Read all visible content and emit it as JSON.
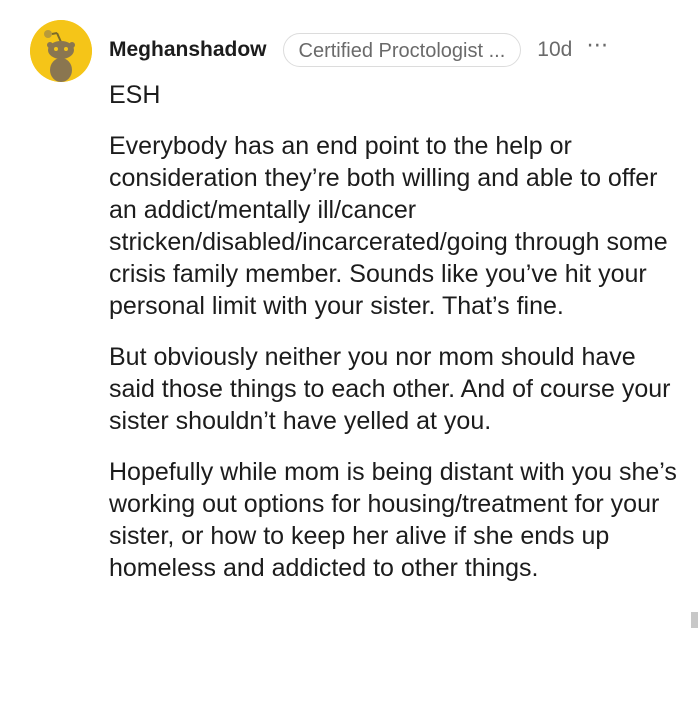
{
  "comment": {
    "username": "Meghanshadow",
    "flair": "Certified Proctologist ...",
    "timestamp": "10d",
    "more_icon": "⋯",
    "paragraphs": [
      "ESH",
      "Everybody has an end point to the help or consideration they’re both willing and able to offer an addict/mentally ill/cancer stricken/disabled/incarcerated/going through some crisis family member. Sounds like you’ve hit your personal limit with your sister. That’s fine.",
      "But obviously neither you nor mom should have said those things to each other. And of course your sister shouldn’t have yelled at you.",
      "Hopefully while mom is being distant with you she’s working out options for housing/treatment for your sister, or how to keep her alive if she ends up homeless and addicted to other things."
    ]
  },
  "colors": {
    "avatar_bg": "#f5c518",
    "text": "#1c1c1c",
    "muted": "#6a6a6a",
    "flair_border": "#dcdcdc"
  }
}
